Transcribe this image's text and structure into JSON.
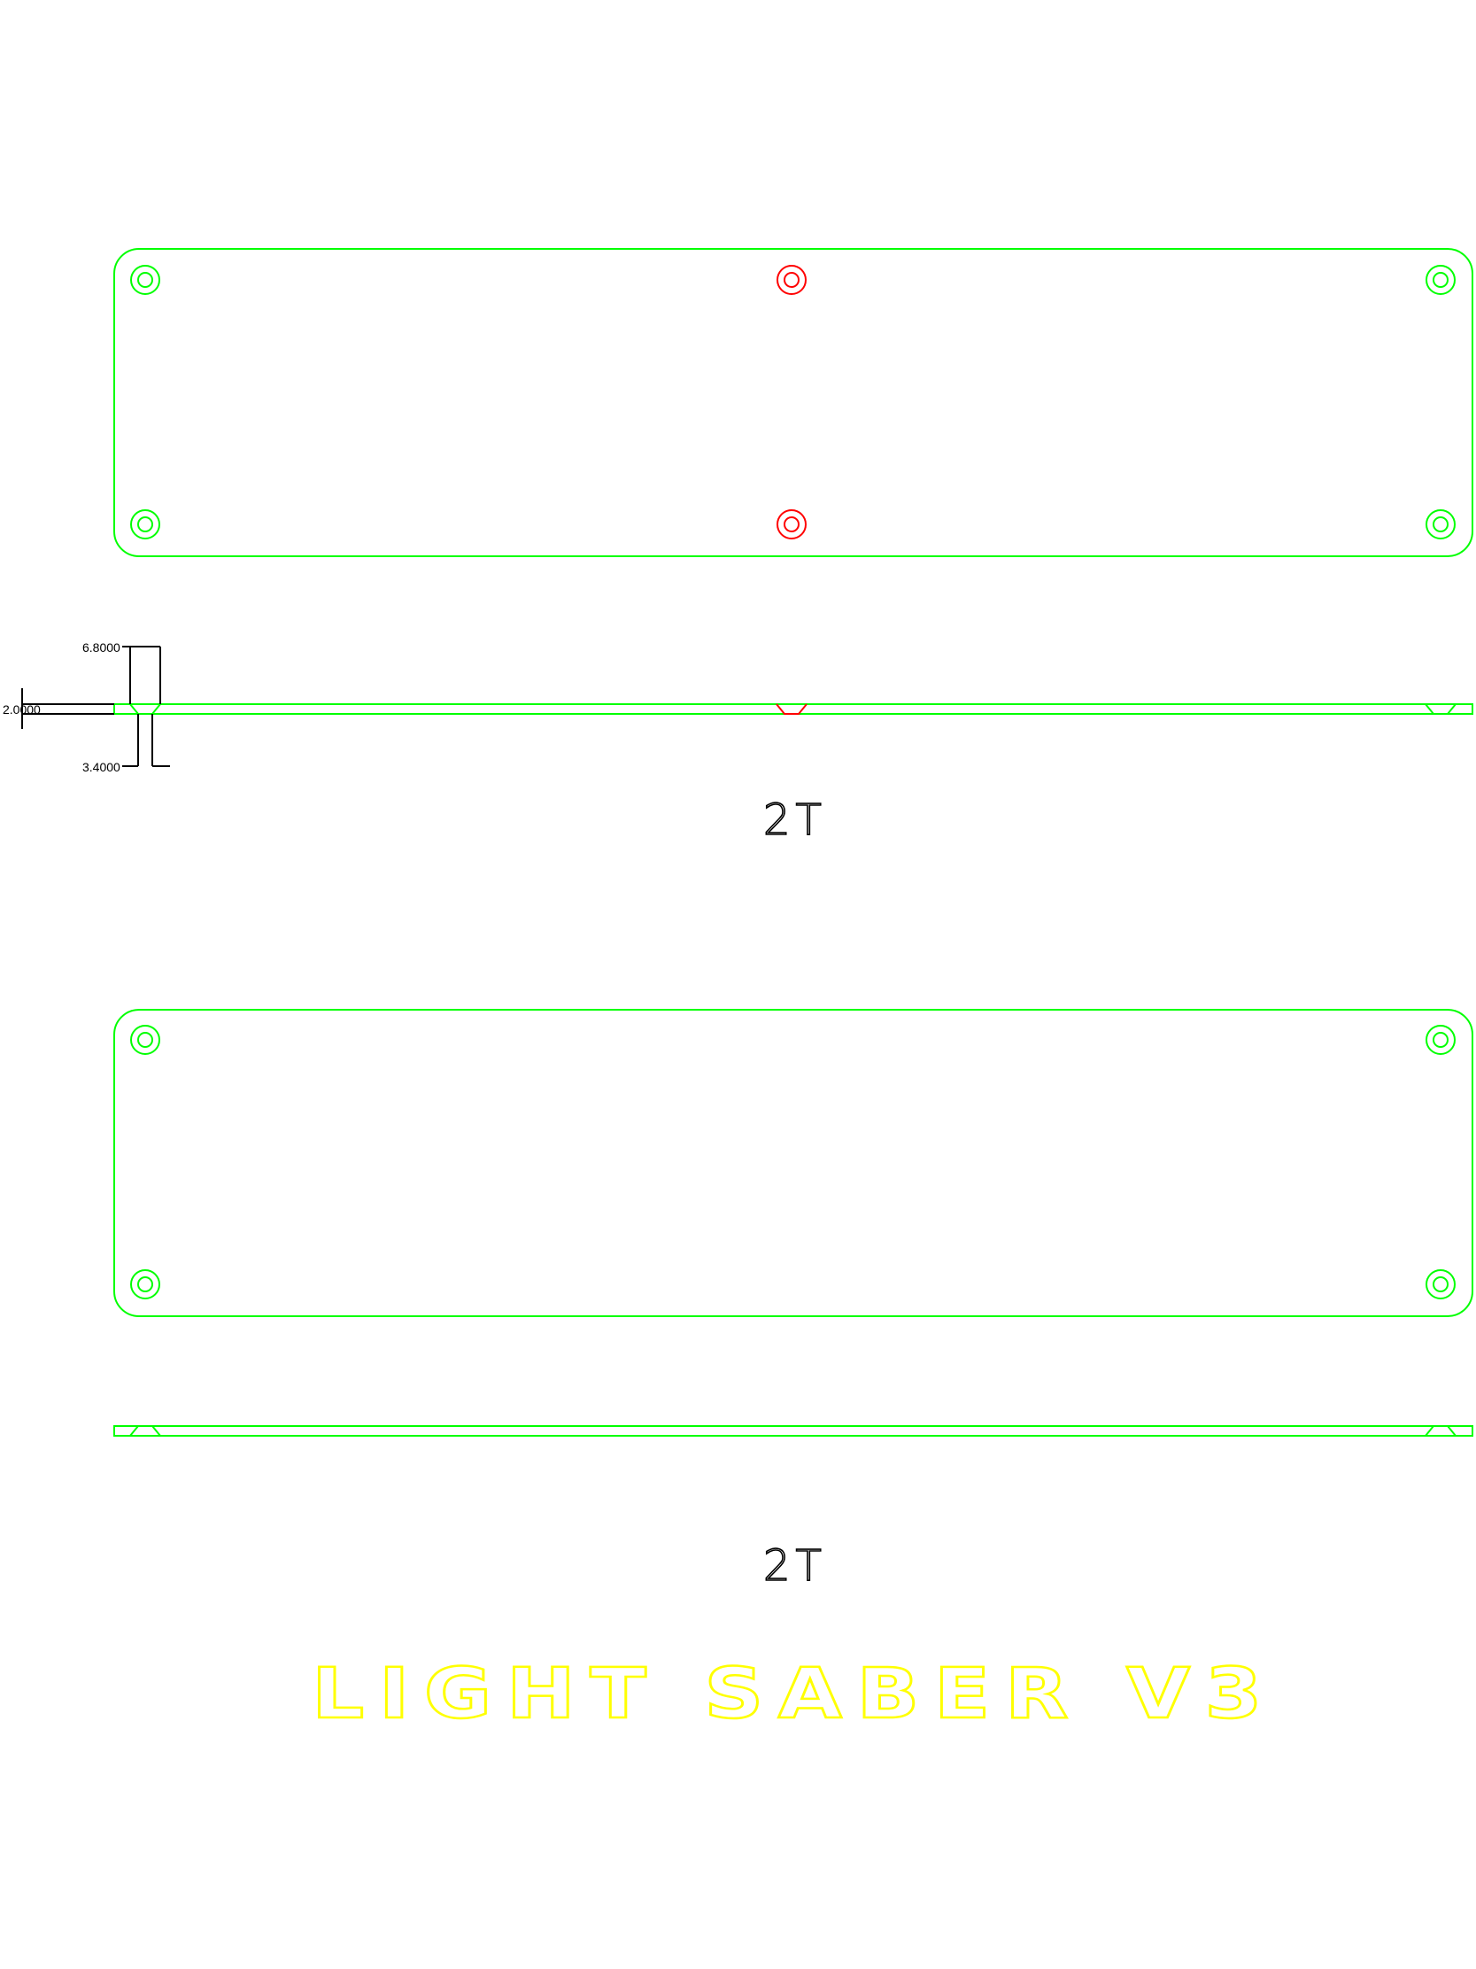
{
  "drawing": {
    "part1": {
      "label": "2T",
      "dimensions": {
        "countersink_diameter": "6.8000",
        "thickness": "2.0000",
        "hole_diameter": "3.4000"
      }
    },
    "part2": {
      "label": "2T"
    },
    "title": "LIGHT SABER V3",
    "colors": {
      "outline": "#00ff00",
      "center_holes": "#ff0000",
      "dimensions": "#000000",
      "title": "#ffff00"
    }
  }
}
